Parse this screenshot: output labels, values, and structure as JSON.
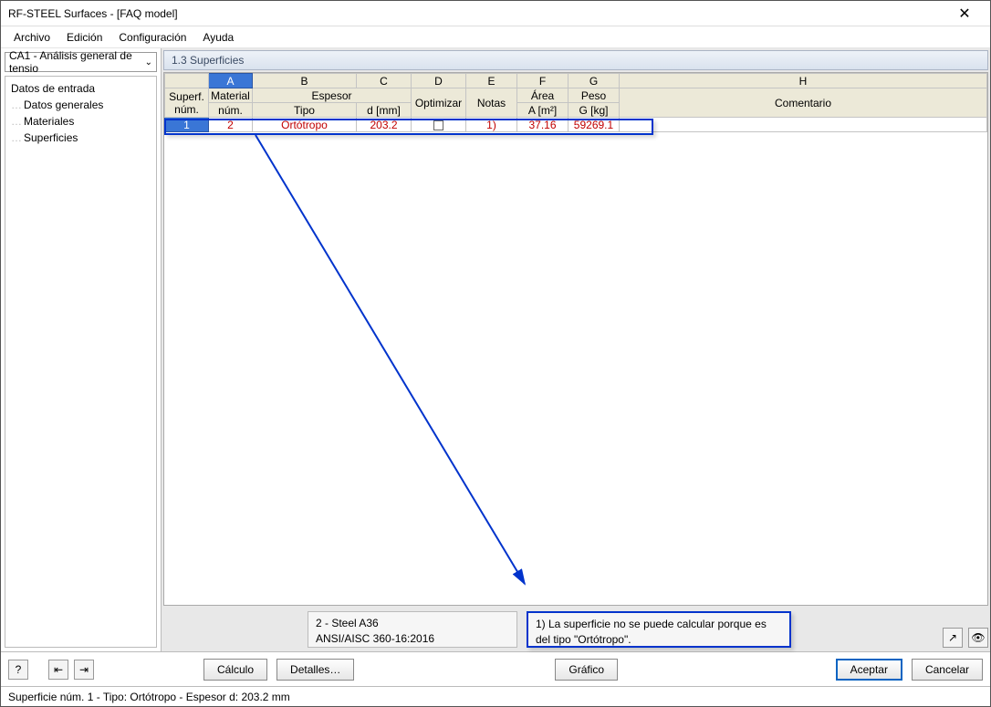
{
  "window": {
    "title": "RF-STEEL Surfaces - [FAQ model]"
  },
  "menu": {
    "file": "Archivo",
    "edit": "Edición",
    "config": "Configuración",
    "help": "Ayuda"
  },
  "left": {
    "dropdown": "CA1 - Análisis general de tensio",
    "tree_root": "Datos de entrada",
    "tree_items": [
      "Datos generales",
      "Materiales",
      "Superficies"
    ]
  },
  "section": {
    "title": "1.3 Superficies"
  },
  "grid": {
    "letters": [
      "A",
      "B",
      "C",
      "D",
      "E",
      "F",
      "G",
      "H"
    ],
    "header1": {
      "surf": "Superf.",
      "mat": "Material",
      "thick": "Espesor",
      "area": "Área",
      "weight": "Peso"
    },
    "header2": {
      "num": "núm.",
      "matnum": "núm.",
      "tipo": "Tipo",
      "d": "d [mm]",
      "opt": "Optimizar",
      "notas": "Notas",
      "A": "A [m²]",
      "G": "G [kg]",
      "comment": "Comentario"
    },
    "row": {
      "n": "1",
      "mat": "2",
      "tipo": "Ortótropo",
      "d": "203.2",
      "notas": "1)",
      "area": "37.16",
      "G": "59269.1"
    }
  },
  "info": {
    "mat1": "2 - Steel A36",
    "mat2": "ANSI/AISC 360-16:2016"
  },
  "note": {
    "text": "1) La superficie no se puede calcular porque es del tipo \"Ortótropo\"."
  },
  "footer": {
    "calc": "Cálculo",
    "details": "Detalles…",
    "graph": "Gráfico",
    "ok": "Aceptar",
    "cancel": "Cancelar"
  },
  "status": {
    "text": "Superficie núm. 1  -  Tipo: Ortótropo  -  Espesor d: 203.2 mm"
  }
}
